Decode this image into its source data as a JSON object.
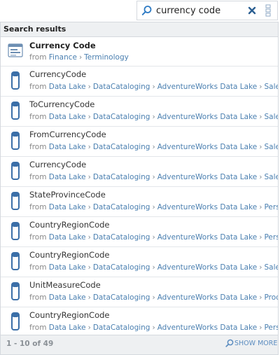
{
  "search": {
    "query": "currency code",
    "clear_icon": "close-icon",
    "filter_icon": "vertical-more-icon"
  },
  "panel": {
    "header": "Search results"
  },
  "results": [
    {
      "icon": "business-term-icon",
      "title": "Currency Code",
      "from": "from",
      "path": [
        "Finance",
        "Terminology"
      ]
    },
    {
      "icon": "column-icon",
      "title": "CurrencyCode",
      "from": "from",
      "path": [
        "Data Lake",
        "DataCataloging",
        "AdventureWorks Data Lake",
        "Sales"
      ]
    },
    {
      "icon": "column-icon",
      "title": "ToCurrencyCode",
      "from": "from",
      "path": [
        "Data Lake",
        "DataCataloging",
        "AdventureWorks Data Lake",
        "Sales"
      ]
    },
    {
      "icon": "column-icon",
      "title": "FromCurrencyCode",
      "from": "from",
      "path": [
        "Data Lake",
        "DataCataloging",
        "AdventureWorks Data Lake",
        "Sales"
      ]
    },
    {
      "icon": "column-icon",
      "title": "CurrencyCode",
      "from": "from",
      "path": [
        "Data Lake",
        "DataCataloging",
        "AdventureWorks Data Lake",
        "Sales"
      ]
    },
    {
      "icon": "column-icon",
      "title": "StateProvinceCode",
      "from": "from",
      "path": [
        "Data Lake",
        "DataCataloging",
        "AdventureWorks Data Lake",
        "Person"
      ]
    },
    {
      "icon": "column-icon",
      "title": "CountryRegionCode",
      "from": "from",
      "path": [
        "Data Lake",
        "DataCataloging",
        "AdventureWorks Data Lake",
        "Person"
      ]
    },
    {
      "icon": "column-icon",
      "title": "CountryRegionCode",
      "from": "from",
      "path": [
        "Data Lake",
        "DataCataloging",
        "AdventureWorks Data Lake",
        "Sales"
      ]
    },
    {
      "icon": "column-icon",
      "title": "UnitMeasureCode",
      "from": "from",
      "path": [
        "Data Lake",
        "DataCataloging",
        "AdventureWorks Data Lake",
        "Production"
      ]
    },
    {
      "icon": "column-icon",
      "title": "CountryRegionCode",
      "from": "from",
      "path": [
        "Data Lake",
        "DataCataloging",
        "AdventureWorks Data Lake",
        "Person"
      ]
    }
  ],
  "footer": {
    "pager": "1 - 10 of 49",
    "show_more": "SHOW MORE"
  },
  "colors": {
    "accent": "#2f7bc4",
    "link": "#4a7fb0",
    "header_bg": "#eef0f2",
    "icon_blue": "#3b6fa8"
  }
}
